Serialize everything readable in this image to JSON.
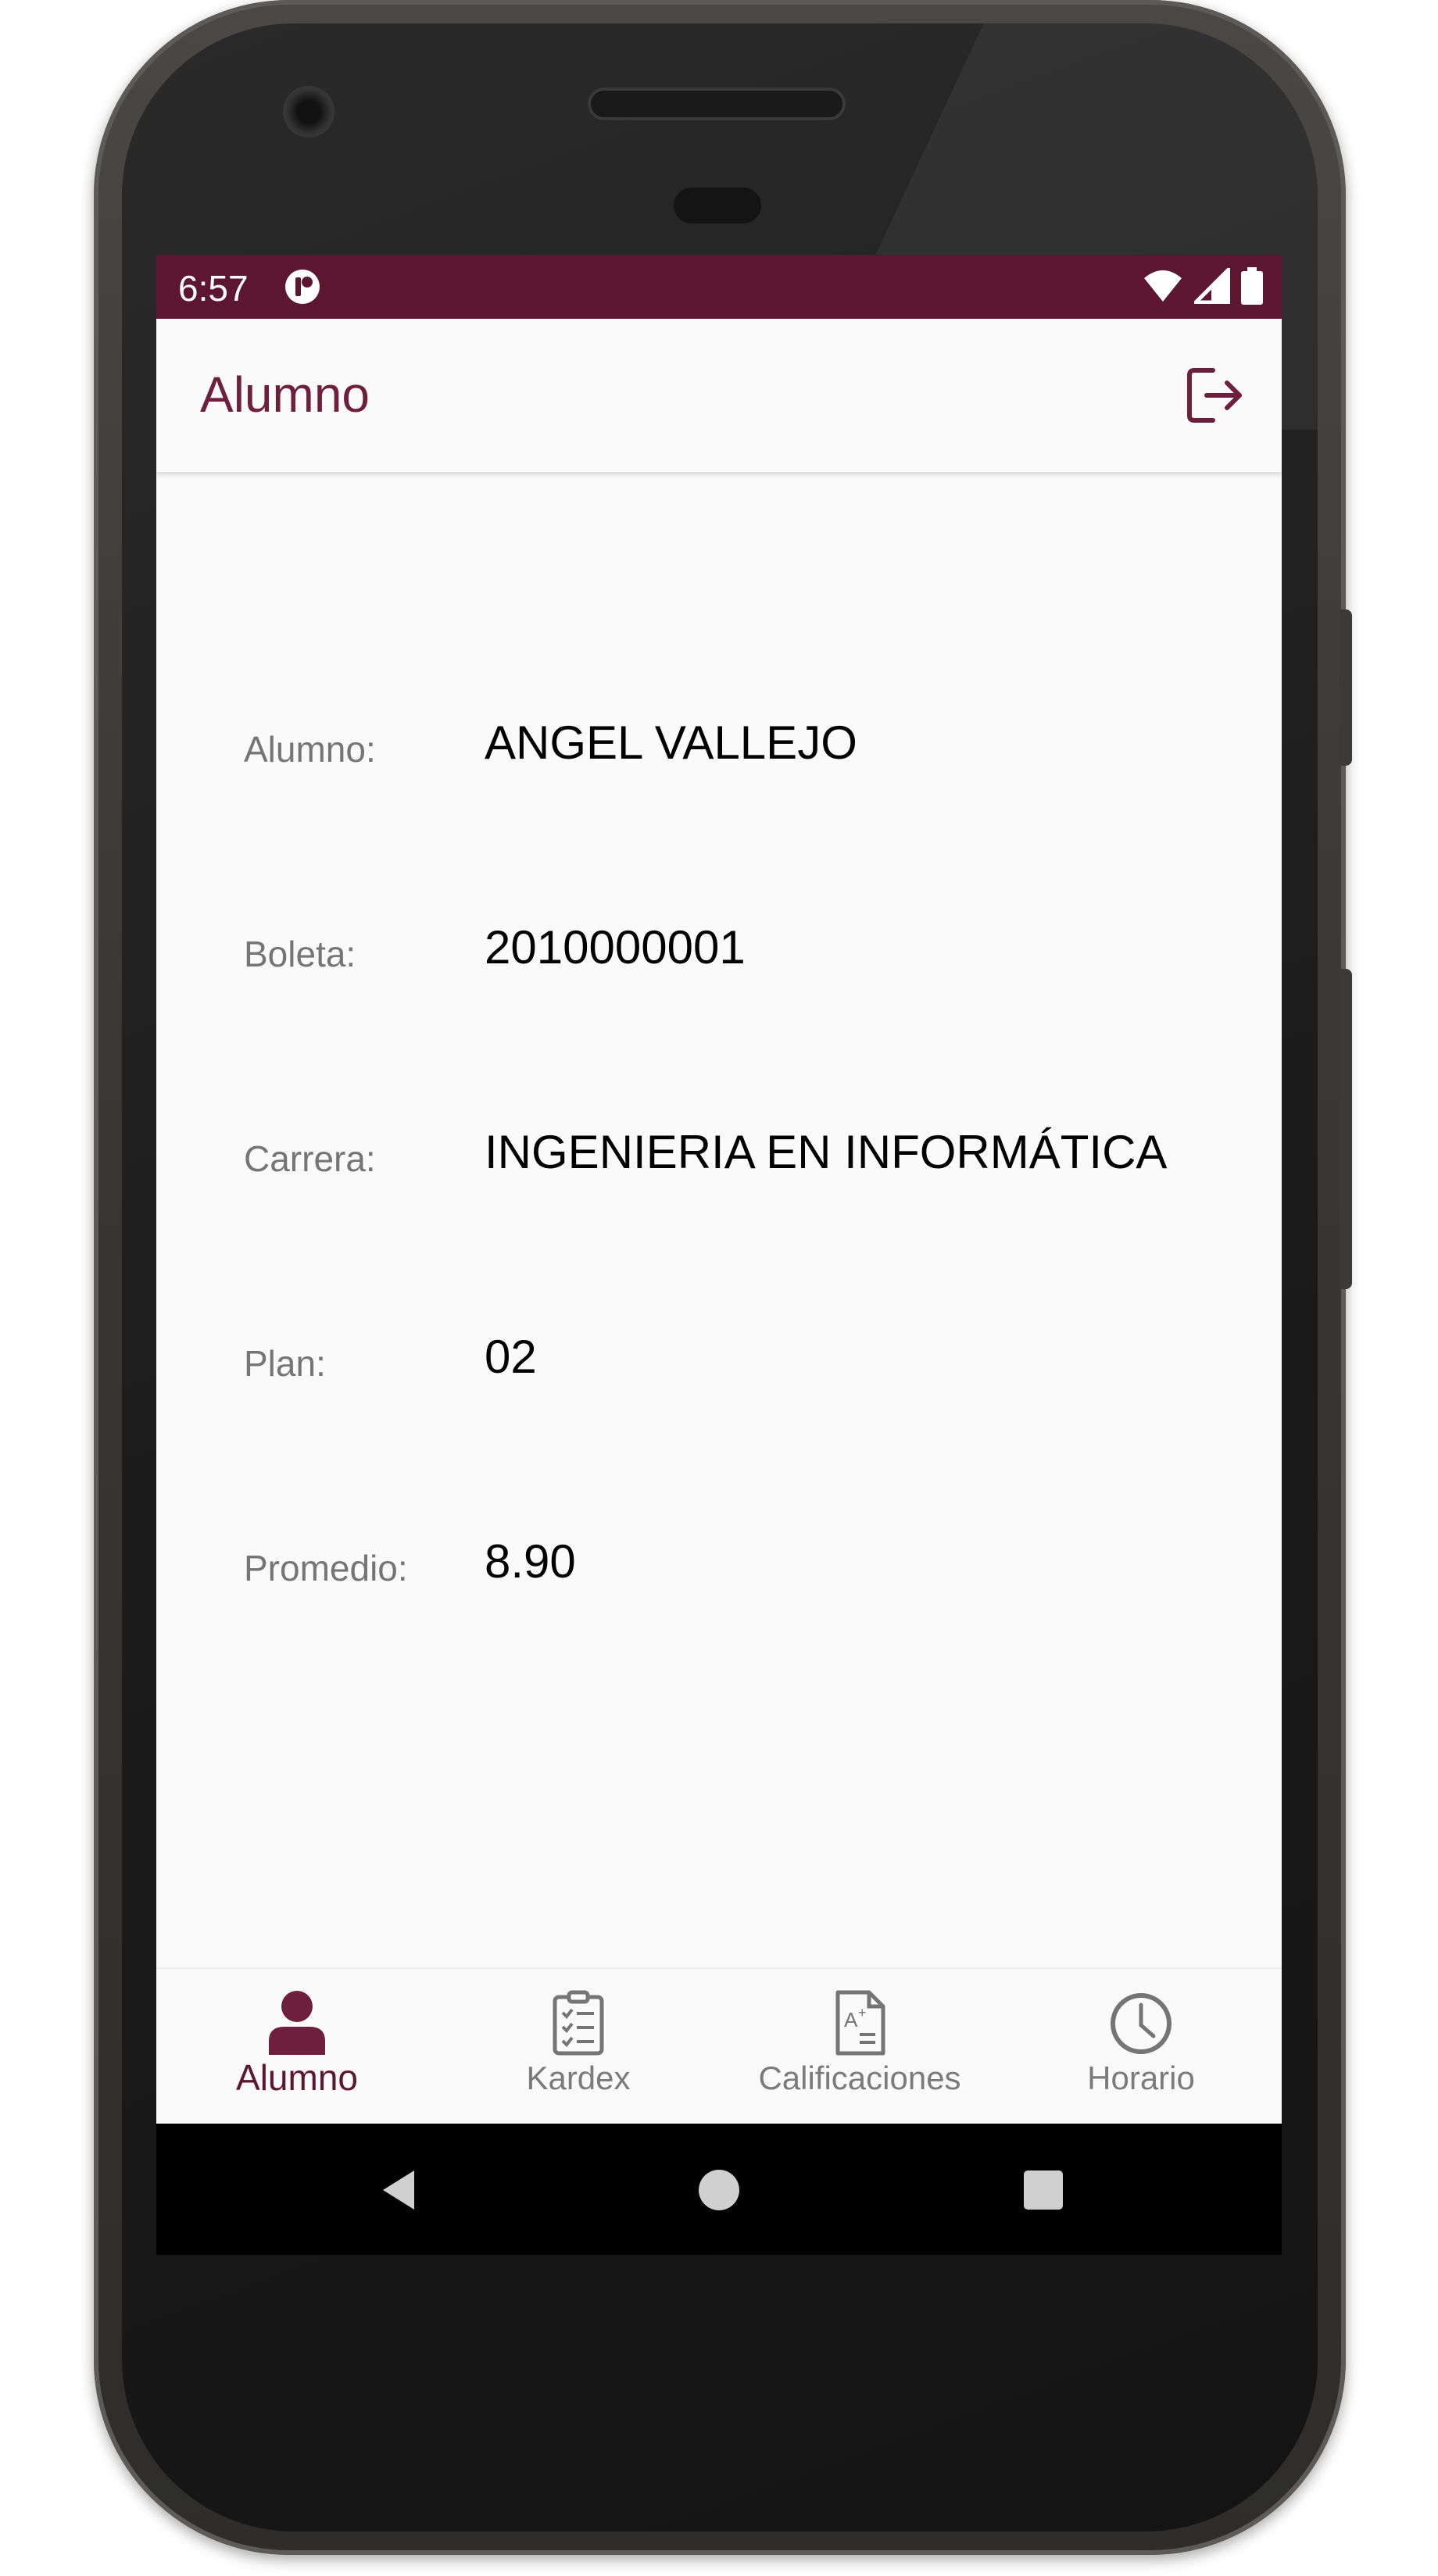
{
  "status_bar": {
    "time": "6:57",
    "background": "#5d1630"
  },
  "app_bar": {
    "title": "Alumno",
    "accent": "#6d1f3c",
    "logout_icon": "logout-icon"
  },
  "student": {
    "fields": [
      {
        "label": "Alumno:",
        "value": "ANGEL VALLEJO"
      },
      {
        "label": "Boleta:",
        "value": "2010000001"
      },
      {
        "label": "Carrera:",
        "value": "INGENIERIA EN INFORMÁTICA"
      },
      {
        "label": "Plan:",
        "value": "02"
      },
      {
        "label": "Promedio:",
        "value": "8.90"
      }
    ]
  },
  "bottom_nav": {
    "active_color": "#5d1630",
    "items": [
      {
        "label": "Alumno",
        "icon": "person-icon",
        "active": true
      },
      {
        "label": "Kardex",
        "icon": "clipboard-list-icon",
        "active": false
      },
      {
        "label": "Calificaciones",
        "icon": "grade-document-icon",
        "active": false
      },
      {
        "label": "Horario",
        "icon": "clock-icon",
        "active": false
      }
    ]
  },
  "system_nav": {
    "buttons": [
      "back-icon",
      "home-icon",
      "recents-icon"
    ]
  }
}
